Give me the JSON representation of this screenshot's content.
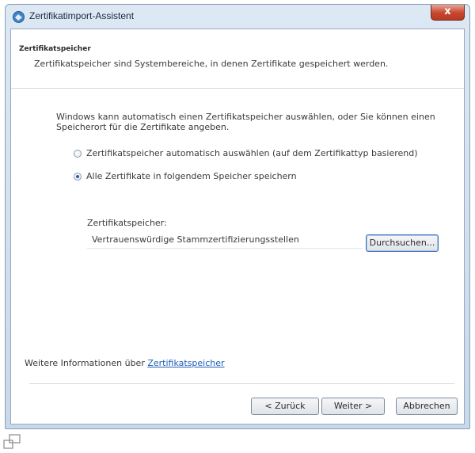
{
  "window": {
    "title": "Zertifikatimport-Assistent",
    "close_label": "x"
  },
  "header": {
    "title": "Zertifikatspeicher",
    "subtitle": "Zertifikatspeicher sind Systembereiche, in denen Zertifikate gespeichert werden."
  },
  "body": {
    "description": "Windows kann automatisch einen Zertifikatspeicher auswählen, oder Sie können einen Speicherort für die Zertifikate angeben.",
    "options": [
      {
        "label": "Zertifikatspeicher automatisch auswählen (auf dem Zertifikattyp basierend)",
        "selected": false
      },
      {
        "label": "Alle Zertifikate in folgendem Speicher speichern",
        "selected": true
      }
    ],
    "store_label": "Zertifikatspeicher:",
    "store_value": "Vertrauenswürdige Stammzertifizierungsstellen",
    "browse_label": "Durchsuchen...",
    "more_info_prefix": "Weitere Informationen über",
    "more_info_link": "Zertifikatspeicher"
  },
  "footer": {
    "back_label": "< Zurück",
    "next_label": "Weiter >",
    "cancel_label": "Abbrechen"
  },
  "colors": {
    "link": "#1f5fb8",
    "close_button": "#c7452d",
    "title_bar": "#dce8f4"
  }
}
